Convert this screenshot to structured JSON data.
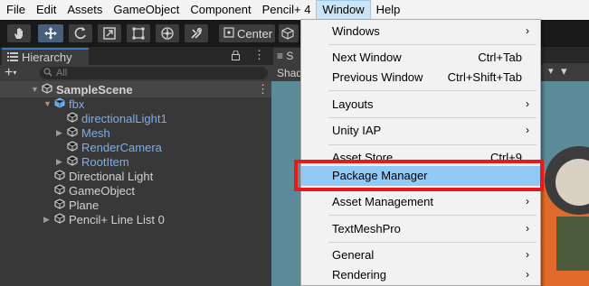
{
  "menubar": {
    "items": [
      "File",
      "Edit",
      "Assets",
      "GameObject",
      "Component",
      "Pencil+ 4",
      "Window",
      "Help"
    ]
  },
  "toolbar": {
    "tools": [
      "hand-tool",
      "move-tool",
      "rotate-tool",
      "scale-tool",
      "rect-tool",
      "transform-tool",
      "custom-tool"
    ],
    "pivot_label": "Center"
  },
  "hierarchy": {
    "tab_label": "Hierarchy",
    "search_placeholder": "All",
    "scene_name": "SampleScene",
    "rows": [
      {
        "label": "fbx",
        "prefab": true
      },
      {
        "label": "directionalLight1",
        "prefab": true
      },
      {
        "label": "Mesh",
        "prefab": true
      },
      {
        "label": "RenderCamera",
        "prefab": true
      },
      {
        "label": "RootItem",
        "prefab": true
      },
      {
        "label": "Directional Light",
        "prefab": false
      },
      {
        "label": "GameObject",
        "prefab": false
      },
      {
        "label": "Plane",
        "prefab": false
      },
      {
        "label": "Pencil+ Line List 0",
        "prefab": false
      }
    ]
  },
  "scene": {
    "tab_label": "S",
    "shading_label": "Shad"
  },
  "window_menu": {
    "items": [
      {
        "label": "Windows",
        "shortcut": "",
        "submenu": true
      },
      {
        "label": "Next Window",
        "shortcut": "Ctrl+Tab",
        "submenu": false
      },
      {
        "label": "Previous Window",
        "shortcut": "Ctrl+Shift+Tab",
        "submenu": false
      },
      {
        "label": "Layouts",
        "shortcut": "",
        "submenu": true
      },
      {
        "label": "Unity IAP",
        "shortcut": "",
        "submenu": true
      },
      {
        "label": "Asset Store",
        "shortcut": "Ctrl+9",
        "submenu": false
      },
      {
        "label": "Package Manager",
        "shortcut": "",
        "submenu": false
      },
      {
        "label": "Asset Management",
        "shortcut": "",
        "submenu": true
      },
      {
        "label": "TextMeshPro",
        "shortcut": "",
        "submenu": true
      },
      {
        "label": "General",
        "shortcut": "",
        "submenu": true
      },
      {
        "label": "Rendering",
        "shortcut": "",
        "submenu": true
      }
    ],
    "submenu_arrow": "›",
    "highlighted": "Package Manager"
  },
  "colors": {
    "highlight_callout": "#e81919",
    "menu_highlight": "#91c9f7",
    "prefab_text": "#7aadf1"
  }
}
